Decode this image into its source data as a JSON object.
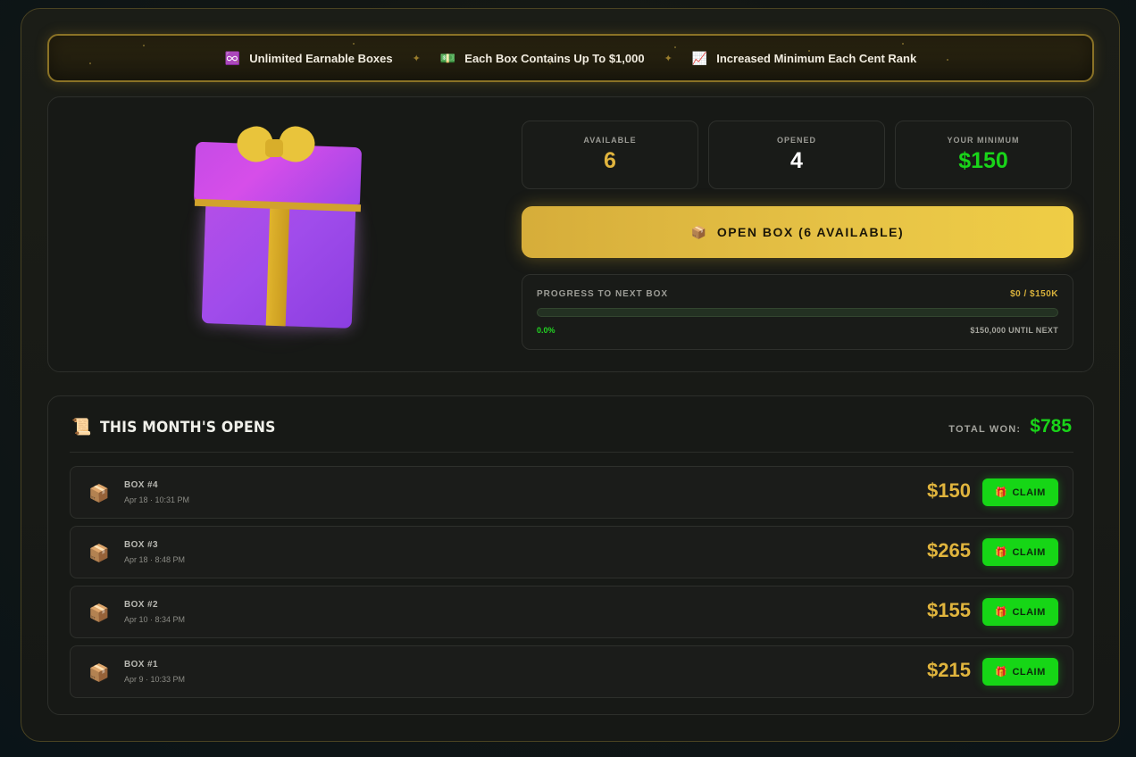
{
  "banner": {
    "features": [
      {
        "icon": "♾️",
        "icon_name": "infinity-icon",
        "label": "Unlimited Earnable Boxes"
      },
      {
        "icon": "💵",
        "icon_name": "money-icon",
        "label": "Each Box Contains Up To $1,000"
      },
      {
        "icon": "📈",
        "icon_name": "chart-up-icon",
        "label": "Increased Minimum Each Cent Rank"
      }
    ],
    "separator": "✦"
  },
  "stats": {
    "available": {
      "label": "AVAILABLE",
      "value": "6",
      "color": "#e0b43d"
    },
    "opened": {
      "label": "OPENED",
      "value": "4",
      "color": "#ffffff"
    },
    "minimum": {
      "label": "YOUR MINIMUM",
      "value": "$150",
      "color": "#19d419"
    }
  },
  "open_button": {
    "icon": "📦",
    "label": "OPEN BOX (6 AVAILABLE)"
  },
  "progress": {
    "title": "PROGRESS TO NEXT BOX",
    "amount": "$0 / $150K",
    "percent_label": "0.0%",
    "fraction": 0.0,
    "until_label": "$150,000 UNTIL NEXT"
  },
  "history": {
    "icon": "📜",
    "title": "THIS MONTH'S OPENS",
    "total_label": "TOTAL WON:",
    "total_value": "$785",
    "rows": [
      {
        "name": "BOX #4",
        "date": "Apr 18 · 10:31 PM",
        "amount": "$150",
        "claim_label": "CLAIM"
      },
      {
        "name": "BOX #3",
        "date": "Apr 18 · 8:48 PM",
        "amount": "$265",
        "claim_label": "CLAIM"
      },
      {
        "name": "BOX #2",
        "date": "Apr 10 · 8:34 PM",
        "amount": "$155",
        "claim_label": "CLAIM"
      },
      {
        "name": "BOX #1",
        "date": "Apr 9 · 10:33 PM",
        "amount": "$215",
        "claim_label": "CLAIM"
      }
    ],
    "row_icon": "📦",
    "claim_icon": "🎁"
  }
}
